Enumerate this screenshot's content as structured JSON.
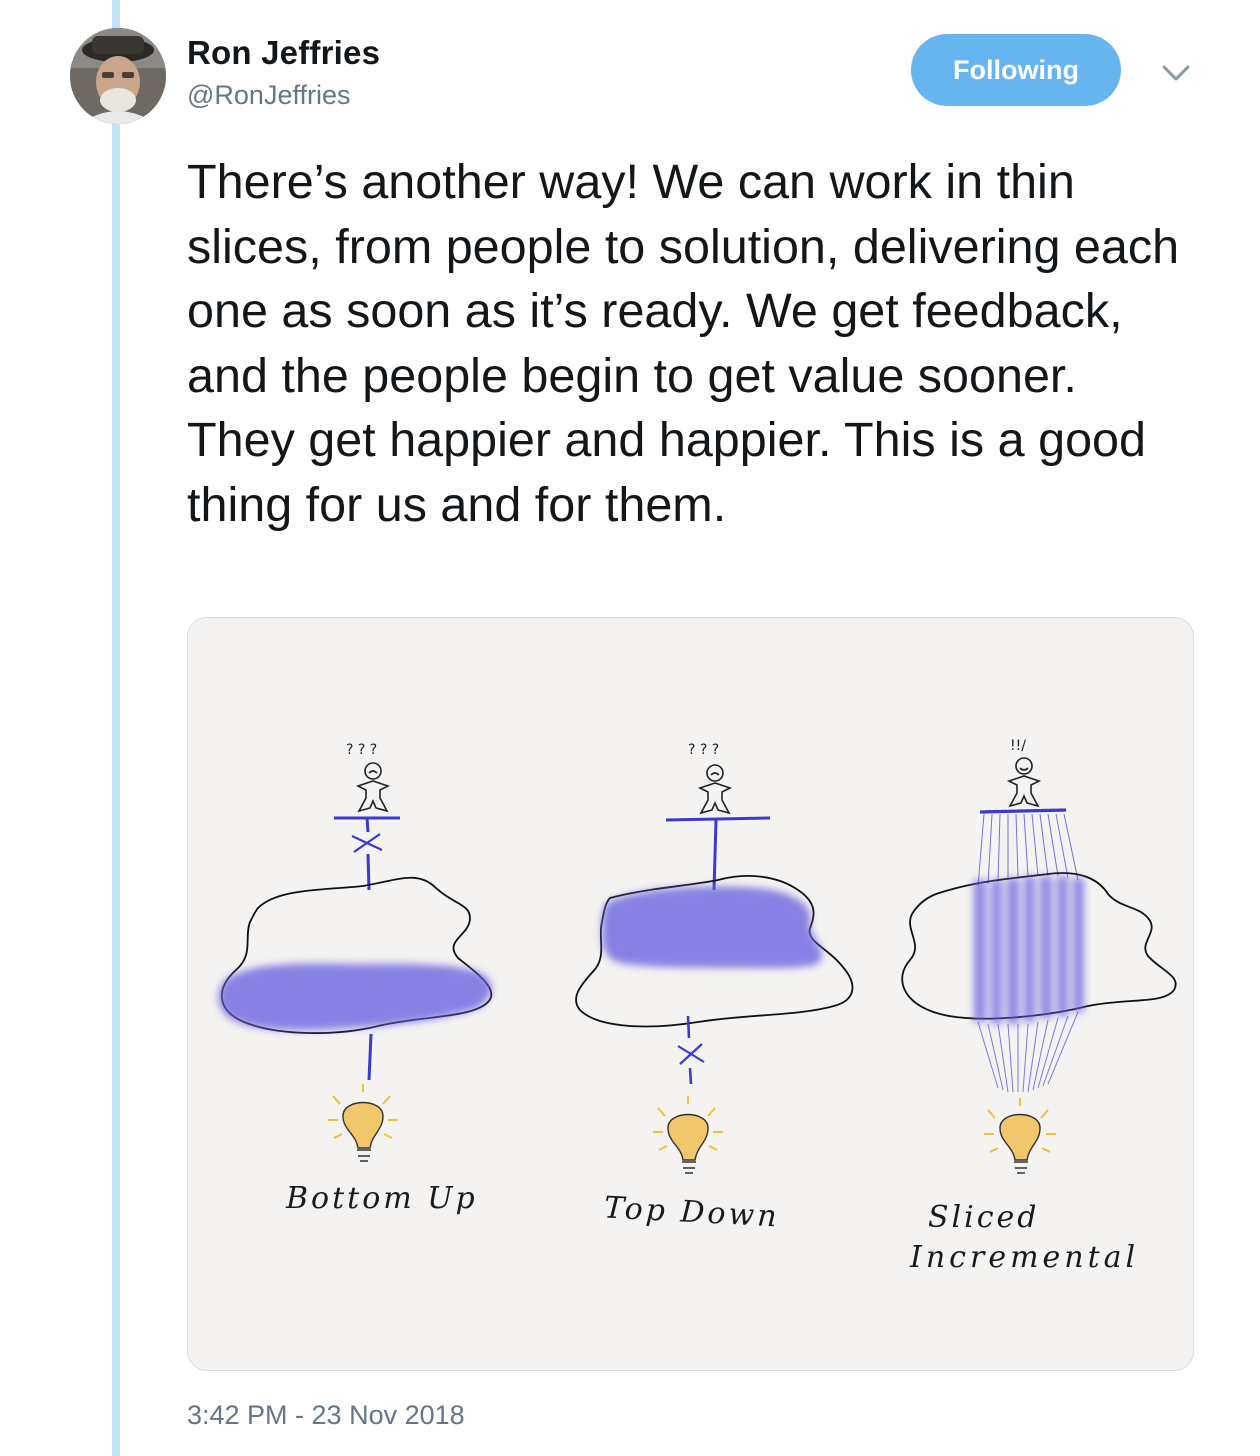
{
  "author": {
    "name": "Ron Jeffries",
    "handle": "@RonJeffries"
  },
  "follow_button": {
    "label": "Following"
  },
  "tweet": {
    "text": "There’s another way! We can work in thin slices, from people to solution, delivering each one as soon as it’s ready. We get feedback, and the people begin to get value sooner. They get happier and happier. This is a good thing for us and for them.",
    "timestamp": "3:42 PM - 23 Nov 2018"
  },
  "diagram": {
    "labels": {
      "bottom_up": "Bottom Up",
      "top_down": "Top Down",
      "sliced_line1": "Sliced",
      "sliced_line2": "Incremental"
    },
    "person_marks": {
      "confused": "? ? ?",
      "happy": "!!/"
    }
  },
  "icons": {
    "caret": "chevron-down-icon",
    "avatar": "user-avatar-photo"
  },
  "colors": {
    "follow_button": "#66b5ef",
    "thread_line": "#c4e3f8",
    "text": "#14171a",
    "secondary_text": "#657786",
    "ink_blue": "#3a3ad0",
    "wash_blue": "#6b62e0",
    "bulb_yellow": "#f2c66b"
  }
}
